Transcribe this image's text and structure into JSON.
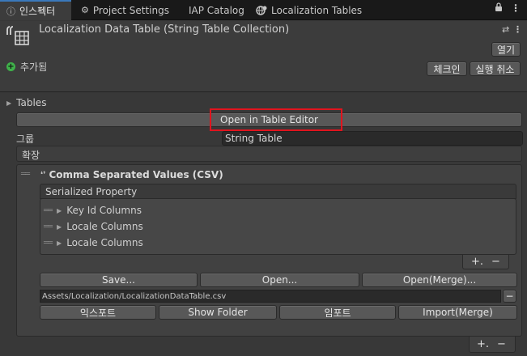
{
  "tabs": [
    {
      "label": "인스펙터",
      "icon": "info-icon"
    },
    {
      "label": "Project Settings",
      "icon": "gear-icon"
    },
    {
      "label": "IAP Catalog",
      "icon": ""
    },
    {
      "label": "Localization Tables",
      "icon": "globe-pin-icon"
    }
  ],
  "window_controls": {
    "lock": "🔒",
    "menu": "⋮"
  },
  "header": {
    "title": "Localization Data Table (String Table Collection)",
    "open_label": "열기",
    "add_label": "추가됨",
    "checkin_label": "체크인",
    "revert_label": "실행 취소"
  },
  "tables": {
    "label": "Tables",
    "open_editor_label": "Open in Table Editor",
    "group_label": "그룹",
    "group_value": "String Table",
    "extensions_label": "확장"
  },
  "csv_extension": {
    "title": "Comma Separated Values (CSV)",
    "serialized_header": "Serialized Property",
    "items": [
      "Key Id Columns",
      "Locale Columns",
      "Locale Columns"
    ],
    "save_label": "Save...",
    "open_label": "Open...",
    "open_merge_label": "Open(Merge)...",
    "path": "Assets/Localization/LocalizationDataTable.csv",
    "export_label": "익스포트",
    "show_folder_label": "Show Folder",
    "import_label": "임포트",
    "import_merge_label": "Import(Merge)"
  },
  "list_controls": {
    "add": "+.",
    "remove": "−"
  }
}
